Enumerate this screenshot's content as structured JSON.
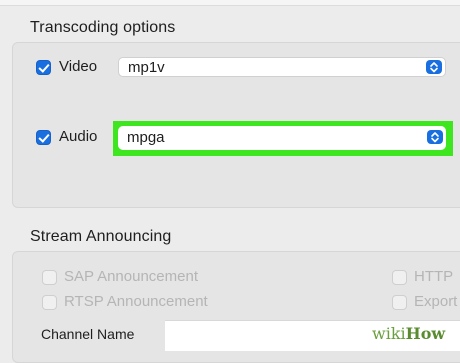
{
  "transcoding": {
    "title": "Transcoding options",
    "video": {
      "label": "Video",
      "checked": true,
      "codec": "mp1v"
    },
    "audio": {
      "label": "Audio",
      "checked": true,
      "codec": "mpga"
    },
    "highlight_color": "#3ee61f"
  },
  "stream": {
    "title": "Stream Announcing",
    "options": [
      {
        "label": "SAP Announcement",
        "enabled": false
      },
      {
        "label": "RTSP Announcement",
        "enabled": false
      },
      {
        "label": "HTTP",
        "enabled": false
      },
      {
        "label": "Export",
        "enabled": false
      }
    ],
    "channel_name_label": "Channel Name"
  },
  "watermark": {
    "wiki": "wiki",
    "how": "How"
  },
  "colors": {
    "accent": "#1a6fe0",
    "background": "#ececec"
  }
}
